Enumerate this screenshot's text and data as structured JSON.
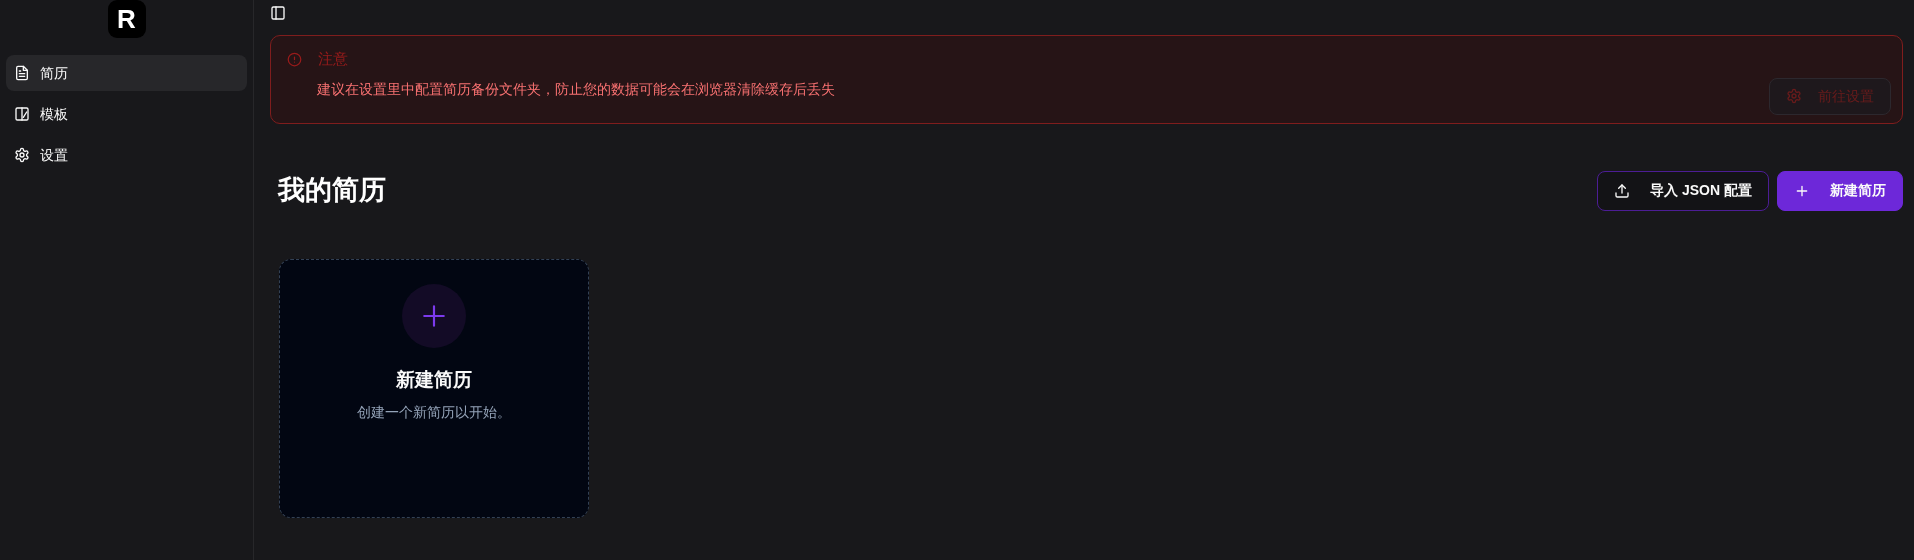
{
  "sidebar": {
    "logo": "R",
    "items": [
      {
        "label": "简历",
        "selected": true
      },
      {
        "label": "模板",
        "selected": false
      },
      {
        "label": "设置",
        "selected": false
      }
    ]
  },
  "alert": {
    "title": "注意",
    "message": "建议在设置里中配置简历备份文件夹，防止您的数据可能会在浏览器清除缓存后丢失",
    "button": {
      "label": "前往设置",
      "disabled": true
    }
  },
  "header": {
    "title": "我的简历",
    "buttons": [
      {
        "label": "导入 JSON 配置",
        "kind": "outline"
      },
      {
        "label": "新建简历",
        "kind": "primary"
      }
    ]
  },
  "cards": [
    {
      "title": "新建简历",
      "description": "创建一个新简历以开始。"
    }
  ]
}
